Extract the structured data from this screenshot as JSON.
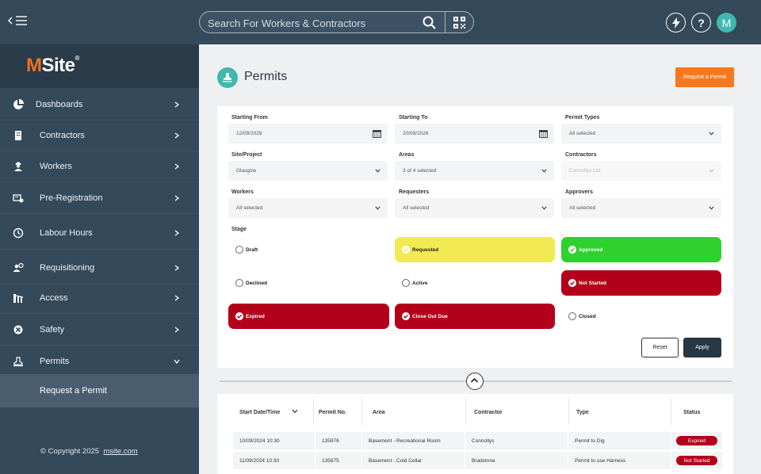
{
  "topbar": {
    "search_placeholder": "Search For Workers & Contractors",
    "icons": [
      "menu-collapse-icon",
      "search-icon",
      "qr-code-icon",
      "lightning-icon",
      "help-icon"
    ],
    "avatar_initial": "M",
    "help_label": "?"
  },
  "sidebar": {
    "logo_m": "M",
    "logo_rest": "Site",
    "logo_reg": "®",
    "items": [
      {
        "label": "Dashboards",
        "icon": "pie-chart-icon"
      },
      {
        "label": "Contractors",
        "icon": "building-icon"
      },
      {
        "label": "Workers",
        "icon": "worker-icon"
      },
      {
        "label": "Pre-Registration",
        "icon": "id-card-icon"
      },
      {
        "label": "Labour Hours",
        "icon": "clock-icon"
      },
      {
        "label": "Requisitioning",
        "icon": "people-icon"
      },
      {
        "label": "Access",
        "icon": "gate-icon"
      },
      {
        "label": "Safety",
        "icon": "safety-icon"
      },
      {
        "label": "Permits",
        "icon": "permit-icon"
      }
    ],
    "sub_item": "Request a Permit",
    "copyright": "© Copyright 2025",
    "copyright_link": "msite.com"
  },
  "header": {
    "title": "Permits",
    "request_button": "Request a Permit"
  },
  "filters": {
    "starting_from": {
      "label": "Starting From",
      "value": "12/09/2026"
    },
    "starting_to": {
      "label": "Starting To",
      "value": "20/09/2026"
    },
    "permit_types": {
      "label": "Permit Types",
      "value": "All selected"
    },
    "site_project": {
      "label": "Site/Project",
      "value": "Glasgow"
    },
    "areas": {
      "label": "Areas",
      "value": "3 of 4 selected"
    },
    "contractors": {
      "label": "Contractors",
      "value": "Connollys Ltd"
    },
    "workers": {
      "label": "Workers",
      "value": "All selected"
    },
    "requesters": {
      "label": "Requesters",
      "value": "All selected"
    },
    "approvers": {
      "label": "Approvers",
      "value": "All selected"
    },
    "stage_label": "Stage",
    "stages": [
      {
        "label": "Draft",
        "selected": false,
        "color": "#ffffff"
      },
      {
        "label": "Requested",
        "selected": true,
        "color": "#f2ea52"
      },
      {
        "label": "Approved",
        "selected": true,
        "color": "#2ed12e"
      },
      {
        "label": "Declined",
        "selected": false,
        "color": "#ffffff"
      },
      {
        "label": "Active",
        "selected": false,
        "color": "#ffffff"
      },
      {
        "label": "Not Started",
        "selected": true,
        "color": "#b3001b"
      },
      {
        "label": "Expired",
        "selected": true,
        "color": "#b3001b"
      },
      {
        "label": "Close Out Due",
        "selected": true,
        "color": "#b3001b"
      },
      {
        "label": "Closed",
        "selected": false,
        "color": "#ffffff"
      }
    ],
    "reset_button": "Reset",
    "apply_button": "Apply"
  },
  "table": {
    "columns": [
      "Start Date/Time",
      "Permit No.",
      "Area",
      "Contractor",
      "Type",
      "Status"
    ],
    "rows": [
      {
        "start": "10/09/2024  10:30",
        "permit_no": "135976",
        "area": "Basement - Recreational Room",
        "contractor": "Connollys",
        "type": "Permit to Dig",
        "status": "Expired"
      },
      {
        "start": "11/09/2024  10:30",
        "permit_no": "135875",
        "area": "Basement - Cold Cellar",
        "contractor": "Bradstone",
        "type": "Permit to use Harness",
        "status": "Not Started"
      }
    ]
  },
  "colors": {
    "topbar": "#34495a",
    "accent_orange": "#f6781f",
    "accent_teal": "#3fb8b0",
    "status_red": "#b3001b",
    "stage_yellow": "#f2ea52",
    "stage_green": "#2ed12e"
  }
}
